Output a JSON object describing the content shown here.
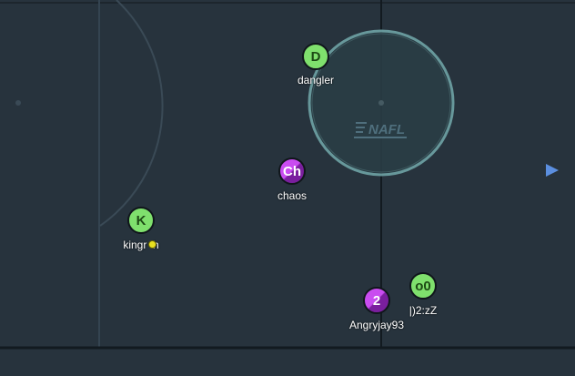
{
  "logo": {
    "text": "NAFL"
  },
  "players": [
    {
      "id": "dangler",
      "initials": "D",
      "name": "dangler",
      "team": "green"
    },
    {
      "id": "chaos",
      "initials": "Ch",
      "name": "chaos",
      "team": "purple"
    },
    {
      "id": "kingrich",
      "initials": "K",
      "name": "kingr  h",
      "team": "green"
    },
    {
      "id": "angryjay93",
      "initials": "2",
      "name": "Angryjay93",
      "team": "purple"
    },
    {
      "id": "o0",
      "initials": "o0",
      "name": "|)2:zZ",
      "team": "green"
    }
  ],
  "colors": {
    "ice": "#27333d",
    "lines": "#121a20",
    "faceoff_circle": "#6fa3a6",
    "green_team": "#7fe06d",
    "purple_team": "#c94cf0",
    "puck": "#e8e020",
    "offscreen_arrow": "#5b8fe0"
  },
  "icons": {
    "puck": "puck-icon",
    "offscreen": "offscreen-arrow-icon"
  }
}
